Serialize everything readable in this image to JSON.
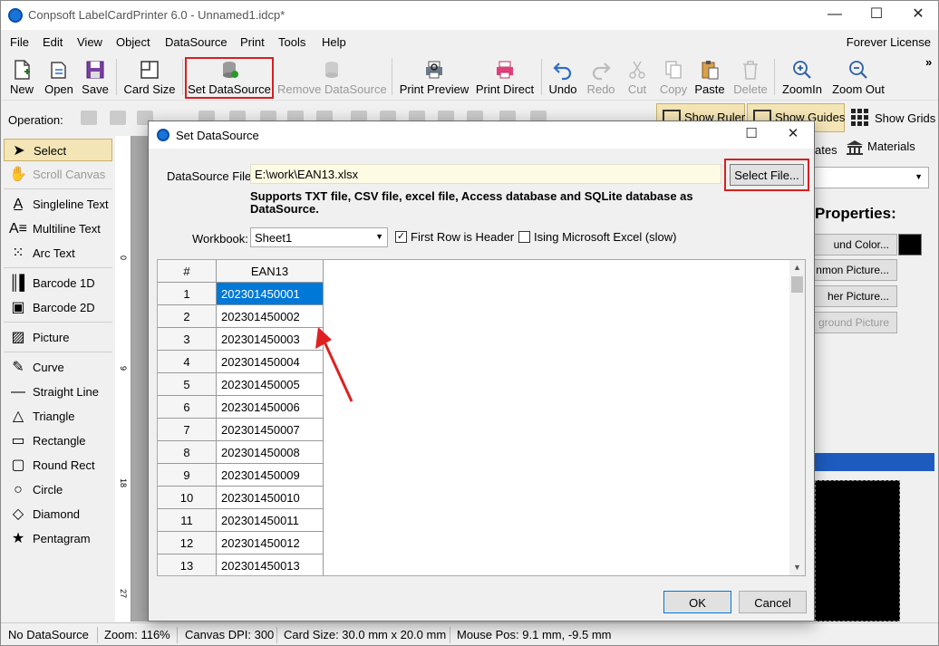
{
  "app": {
    "title": "Conpsoft LabelCardPrinter 6.0 - Unnamed1.idcp*",
    "license": "Forever License",
    "minimize": "—",
    "maximize": "☐",
    "close": "✕"
  },
  "menu": [
    "File",
    "Edit",
    "View",
    "Object",
    "DataSource",
    "Print",
    "Tools",
    "Help"
  ],
  "toolbar": {
    "new": "New",
    "open": "Open",
    "save": "Save",
    "card_size": "Card Size",
    "set_datasource": "Set DataSource",
    "remove_datasource": "Remove DataSource",
    "print_preview": "Print Preview",
    "print_direct": "Print Direct",
    "undo": "Undo",
    "redo": "Redo",
    "cut": "Cut",
    "copy": "Copy",
    "paste": "Paste",
    "delete": "Delete",
    "zoom_in": "ZoomIn",
    "zoom_out": "Zoom Out",
    "overflow": "»"
  },
  "operation": {
    "label": "Operation:",
    "show_ruler": "Show Ruler",
    "show_guides": "Show Guides",
    "show_grids": "Show Grids"
  },
  "left_panel": {
    "select": "Select",
    "scroll_canvas": "Scroll Canvas",
    "singleline_text": "Singleline Text",
    "multiline_text": "Multiline Text",
    "arc_text": "Arc Text",
    "barcode_1d": "Barcode 1D",
    "barcode_2d": "Barcode 2D",
    "picture": "Picture",
    "curve": "Curve",
    "straight_line": "Straight Line",
    "triangle": "Triangle",
    "rectangle": "Rectangle",
    "round_rect": "Round Rect",
    "circle": "Circle",
    "diamond": "Diamond",
    "pentagram": "Pentagram"
  },
  "ruler_labels": [
    "0",
    "9",
    "18",
    "27"
  ],
  "right_panel": {
    "tab_templates": "ates",
    "tab_materials": "Materials",
    "properties_title": "Properties:",
    "btn_bg_color": "und Color...",
    "btn_common_picture": "nmon Picture...",
    "btn_other_picture": "her Picture...",
    "btn_bg_picture": "ground Picture"
  },
  "status": {
    "datasource": "No DataSource",
    "zoom": "Zoom: 116%",
    "dpi": "Canvas DPI: 300",
    "card_size": "Card Size: 30.0 mm x 20.0 mm",
    "mouse_pos": "Mouse Pos: 9.1 mm, -9.5 mm"
  },
  "dialog": {
    "title": "Set DataSource",
    "close": "✕",
    "maximize": "☐",
    "datasource_file_label": "DataSource File:",
    "datasource_file_value": "E:\\work\\EAN13.xlsx",
    "select_file": "Select File...",
    "support_text": "Supports TXT file, CSV file, excel file, Access database and SQLite database as DataSource.",
    "workbook_label": "Workbook:",
    "workbook_value": "Sheet1",
    "first_row_header": "First Row is Header",
    "first_row_header_checked": true,
    "using_excel": "Ising Microsoft Excel (slow)",
    "using_excel_checked": false,
    "grid": {
      "headers": [
        "#",
        "EAN13"
      ],
      "rows": [
        [
          "1",
          "202301450001"
        ],
        [
          "2",
          "202301450002"
        ],
        [
          "3",
          "202301450003"
        ],
        [
          "4",
          "202301450004"
        ],
        [
          "5",
          "202301450005"
        ],
        [
          "6",
          "202301450006"
        ],
        [
          "7",
          "202301450007"
        ],
        [
          "8",
          "202301450008"
        ],
        [
          "9",
          "202301450009"
        ],
        [
          "10",
          "202301450010"
        ],
        [
          "11",
          "202301450011"
        ],
        [
          "12",
          "202301450012"
        ],
        [
          "13",
          "202301450013"
        ]
      ]
    },
    "ok": "OK",
    "cancel": "Cancel"
  },
  "colors": {
    "accent_highlight": "#d62020",
    "selection": "#0078d7",
    "toggle_active": "#f3e5b5"
  }
}
